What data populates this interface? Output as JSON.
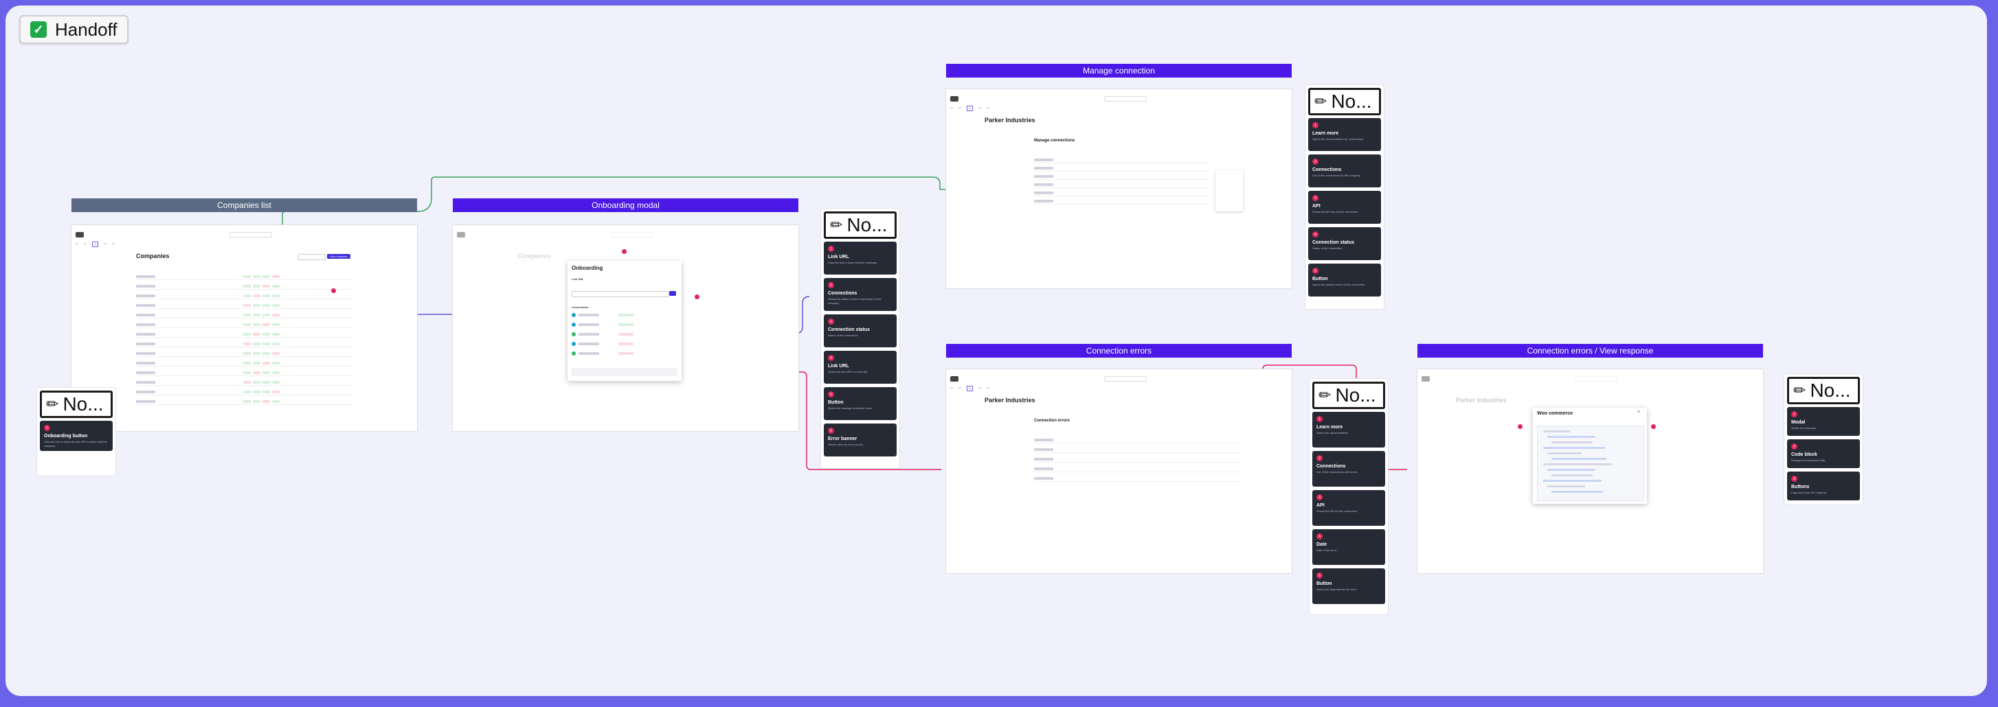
{
  "handoff": {
    "label": "Handoff"
  },
  "sections": {
    "companies_list": "Companies list",
    "onboarding_modal": "Onboarding modal",
    "manage_connection": "Manage connection",
    "connection_errors": "Connection errors",
    "connection_errors_view": "Connection errors / View response"
  },
  "notes_label": "No...",
  "pages": {
    "companies": {
      "title": "Companies",
      "create_button": "New company"
    },
    "onboarding": {
      "title": "Onboarding",
      "link_label": "Link URL",
      "connections_label": "Connections"
    },
    "parker": {
      "title": "Parker Industries",
      "manage_heading": "Manage connections",
      "errors_heading": "Connection errors",
      "view_title": "Woo commerce"
    }
  },
  "notes": {
    "companies": [
      {
        "num": "1",
        "title": "Onboarding button",
        "text": "Click the icon to show the link URL to share with the company."
      }
    ],
    "onboarding": [
      {
        "num": "1",
        "title": "Link URL",
        "text": "Copy the link to share with the company."
      },
      {
        "num": "2",
        "title": "Connections",
        "text": "Shows the status of each connection for the company."
      },
      {
        "num": "3",
        "title": "Connection status",
        "text": "Status of the connection."
      },
      {
        "num": "4",
        "title": "Link URL",
        "text": "Opens the link URL in a new tab."
      },
      {
        "num": "5",
        "title": "Button",
        "text": "Opens the manage connection view."
      },
      {
        "num": "6",
        "title": "Error banner",
        "text": "Shown when an error occurs."
      }
    ],
    "manage": [
      {
        "num": "1",
        "title": "Learn more",
        "text": "Opens the documentation for connections."
      },
      {
        "num": "2",
        "title": "Connections",
        "text": "List of the connections for the company."
      },
      {
        "num": "3",
        "title": "API",
        "text": "Shows the API key for the connection."
      },
      {
        "num": "4",
        "title": "Connection status",
        "text": "Status of the connection."
      },
      {
        "num": "5",
        "title": "Button",
        "text": "Opens the actions menu for the connection."
      }
    ],
    "errors": [
      {
        "num": "1",
        "title": "Learn more",
        "text": "Opens the documentation."
      },
      {
        "num": "2",
        "title": "Connections",
        "text": "List of the connections with errors."
      },
      {
        "num": "3",
        "title": "API",
        "text": "Shows the API for the connection."
      },
      {
        "num": "4",
        "title": "Date",
        "text": "Date of the error."
      },
      {
        "num": "5",
        "title": "Button",
        "text": "Opens the response for the error."
      }
    ],
    "view": [
      {
        "num": "1",
        "title": "Modal",
        "text": "Shows the response."
      },
      {
        "num": "2",
        "title": "Code block",
        "text": "Displays the response body."
      },
      {
        "num": "3",
        "title": "Buttons",
        "text": "Copy and close the response."
      }
    ]
  },
  "colors": {
    "accent": "#4b18e8",
    "slate": "#5a6a85",
    "hotspot": "#e0265a",
    "link_green": "#3aa35e",
    "link_blue": "#5a58d8"
  }
}
